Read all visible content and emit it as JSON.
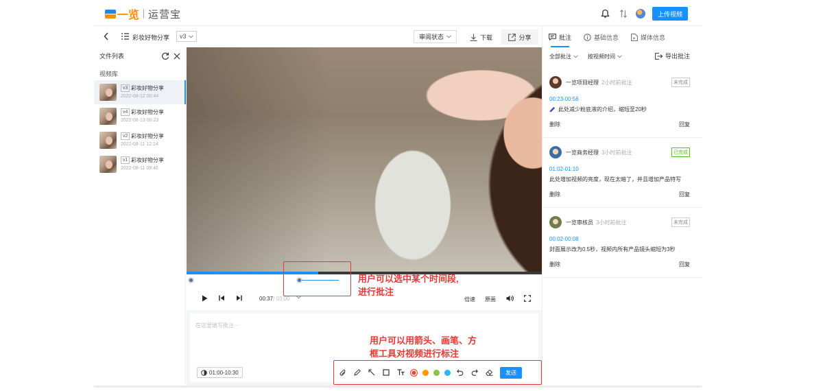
{
  "header": {
    "logo_text": "一览",
    "product_name": "运营宝",
    "upload_label": "上传视频"
  },
  "toolbar": {
    "title": "彩妆好物分享",
    "version": "v3",
    "review_status": "审阅状态",
    "download": "下载",
    "share": "分享"
  },
  "file_panel": {
    "title": "文件列表",
    "library_label": "视频库",
    "items": [
      {
        "version": "v3",
        "name": "彩妆好物分享",
        "date": "2022-08-12 00:44",
        "active": true
      },
      {
        "version": "v4",
        "name": "彩妆好物分享",
        "date": "2022-08-13 00:23",
        "active": false
      },
      {
        "version": "v2",
        "name": "彩妆好物分享",
        "date": "2022-08-11 12:14",
        "active": false
      },
      {
        "version": "v1",
        "name": "彩妆好物分享",
        "date": "2022-08-11 09:46",
        "active": false
      }
    ]
  },
  "player": {
    "progress_fraction": 0.37,
    "current_time": "00:37",
    "total_time": "/ 03:00",
    "speed_label": "倍速",
    "quality_label": "原画"
  },
  "annotation": {
    "placeholder": "在这里填写批注···",
    "time_range": "01:00-10:30",
    "send_label": "发送",
    "colors": [
      "#f44336",
      "#ff9800",
      "#8bc34a",
      "#29b6f6"
    ]
  },
  "callouts": {
    "range_line1": "用户可以选中某个时间段,",
    "range_line2": "进行批注",
    "tools_line1": "用户可以用箭头、画笔、方",
    "tools_line2": "框工具对视频进行标注"
  },
  "right_panel": {
    "tabs": [
      "批注",
      "基础信息",
      "媒体信息"
    ],
    "filter_all": "全部批注",
    "filter_time": "按视频时间",
    "export": "导出批注",
    "comments": [
      {
        "author": "一览项目经理",
        "time": "2小时前批注",
        "status": "未完成",
        "range": "00:23-00:56",
        "text": "此处减少粉底液的介绍，缩短至20秒",
        "delete": "删除",
        "reply": "回复"
      },
      {
        "author": "一览商务经理",
        "time": "3小时前批注",
        "status": "已完成",
        "range": "01:02-01:10",
        "text": "此处增加视频的亮度，现在太暗了，并且增加产品特写",
        "delete": "删除",
        "reply": "回复"
      },
      {
        "author": "一览审核员",
        "time": "3小时前批注",
        "status": "未完成",
        "range": "00:02-00:08",
        "text": "封面展示改为0.5秒，视频内所有产品镜头缩短为3秒",
        "delete": "删除",
        "reply": "回复"
      }
    ]
  }
}
